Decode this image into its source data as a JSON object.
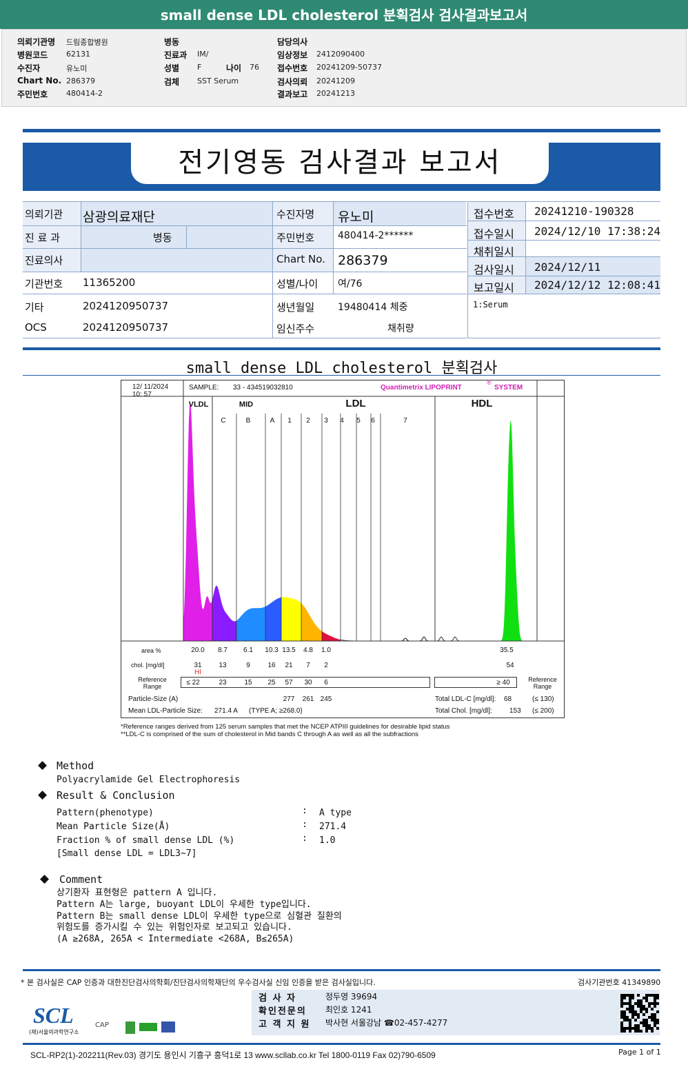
{
  "header": {
    "title": "small dense LDL cholesterol 분획검사 검사결과보고서"
  },
  "info": {
    "col1": [
      {
        "label": "의뢰기관명",
        "value": "드림종합병원"
      },
      {
        "label": "병원코드",
        "value": "62131"
      },
      {
        "label": "수진자",
        "value": "유노미"
      },
      {
        "label": "Chart No.",
        "value": "286379"
      },
      {
        "label": "주민번호",
        "value": "480414-2"
      }
    ],
    "col2": [
      {
        "label": "병동",
        "value": ""
      },
      {
        "label": "진료과",
        "value": "IM/"
      },
      {
        "label": "성별",
        "value": "F"
      },
      {
        "label": "검체",
        "value": "SST Serum"
      }
    ],
    "age_label": "나이",
    "age_value": "76",
    "col3": [
      {
        "label": "담당의사",
        "value": ""
      },
      {
        "label": "임상정보",
        "value": "2412090400"
      },
      {
        "label": "접수번호",
        "value": "20241209-50737"
      },
      {
        "label": "검사의뢰",
        "value": "20241209"
      },
      {
        "label": "결과보고",
        "value": "20241213"
      }
    ]
  },
  "report": {
    "title": "전기영동 검사결과 보고서",
    "left": [
      {
        "l1": "의뢰기관",
        "v1": "삼광의료재단",
        "l2": "수진자명",
        "v2": "유노미"
      },
      {
        "l1": "진 료 과",
        "v1": "병동",
        "l2": "주민번호",
        "v2": "480414-2******"
      },
      {
        "l1": "진료의사",
        "v1": "",
        "l2": "Chart No.",
        "v2": "286379"
      },
      {
        "l1": "기관번호",
        "v1": "11365200",
        "l2": "성별/나이",
        "v2": "여/76"
      },
      {
        "l1": "기타",
        "v1": "2024120950737",
        "l2": "생년월일",
        "v2": "19480414 체중"
      },
      {
        "l1": "OCS",
        "v1": "2024120950737",
        "l2": "임신주수",
        "v2": "채취량"
      }
    ],
    "right": [
      {
        "l": "접수번호",
        "v": "20241210-190328"
      },
      {
        "l": "접수일시",
        "v": "2024/12/10 17:38:24"
      },
      {
        "l": "채취일시",
        "v": ""
      },
      {
        "l": "검사일시",
        "v": "2024/12/11"
      },
      {
        "l": "보고일시",
        "v": "2024/12/12 12:08:41"
      }
    ],
    "specimen": "1:Serum",
    "subtitle": "small dense LDL cholesterol 분획검사"
  },
  "chart_data": {
    "type": "area",
    "date": "12/ 11/2024",
    "time": "10: 57",
    "sample_label": "SAMPLE:",
    "sample": "33 - 434519032810",
    "brand": "Quantimetrix LIPOPRINT",
    "brand_mark": "®",
    "brand_suffix": "SYSTEM",
    "groups": [
      "VLDL",
      "MID",
      "LDL",
      "HDL"
    ],
    "bands": [
      "C",
      "B",
      "A",
      "1",
      "2",
      "3",
      "4",
      "5",
      "6",
      "7"
    ],
    "colors": {
      "VLDL": "#e020e8",
      "C": "#8a1cff",
      "B": "#1f8cff",
      "A": "#2a5cff",
      "1": "#ffff00",
      "2": "#ffb400",
      "3": "#e0103c",
      "HDL": "#10e010"
    },
    "row_labels": {
      "area": "area %",
      "chol": "chol. [mg/dl]",
      "ref": "Reference Range",
      "ref_right": "Reference Range",
      "particle": "Particle-Size (A)",
      "mean": "Mean LDL-Particle Size:"
    },
    "area": [
      "20.0",
      "8.7",
      "6.1",
      "10.3",
      "13.5",
      "4.8",
      "1.0"
    ],
    "area_hdl": "35.5",
    "chol": [
      "31",
      "13",
      "9",
      "16",
      "21",
      "7",
      "2"
    ],
    "chol_hdl": "54",
    "chol_flag": "HI",
    "ref": [
      "≤ 22",
      "23",
      "15",
      "25",
      "57",
      "30",
      "6"
    ],
    "ref_hdl": "≥  40",
    "particle": [
      "277",
      "261",
      "245"
    ],
    "mean_value": "271.4  A",
    "mean_type": "(TYPE A; ≥268.0)",
    "total_ldl_label": "Total LDL-C  [mg/dl]:",
    "total_ldl": "68",
    "total_ldl_ref": "(≤ 130)",
    "total_chol_label": "Total Chol.  [mg/dl]:",
    "total_chol": "153",
    "total_chol_ref": "(≤ 200)",
    "footnote1": "*Reference ranges derived from 125 serum samples that met the NCEP ATPIII guidelines for desirable lipid status",
    "footnote2": "**LDL-C is comprised of the sum of cholesterol in Mid bands C through A as well as all the subfractions"
  },
  "method": {
    "title": "Method",
    "text": "Polyacrylamide Gel Electrophoresis"
  },
  "result": {
    "title": "Result & Conclusion",
    "rows": [
      {
        "l": "Pattern(phenotype)",
        "v": "A type"
      },
      {
        "l": "Mean Particle Size(Å)",
        "v": "271.4"
      },
      {
        "l": "Fraction % of small dense LDL (%)",
        "v": "1.0"
      }
    ],
    "note": "[Small dense LDL = LDL3~7]",
    "sep": ":"
  },
  "comment": {
    "title": "Comment",
    "lines": [
      "상기환자 표현형은 pattern A 입니다.",
      "Pattern A는 large, buoyant LDL이 우세한 type입니다.",
      "Pattern B는 small dense LDL이 우세한 type으로 심혈관 질환의",
      "위험도를 증가시킬 수 있는 위험인자로 보고되고 있습니다.",
      "(A ≥268A, 265A < Intermediate <268A, B≤265A)"
    ]
  },
  "footer": {
    "cert": "* 본 검사실은 CAP 인증과 대한진단검사의학회/진단검사의학재단의 우수검사실 신임 인증을 받은 검사실입니다.",
    "org_no": "검사기관번호 41349890",
    "staff": [
      {
        "l": "검  사  자",
        "v": "정두영 39694"
      },
      {
        "l": "확인전문의",
        "v": "최인호 1241"
      },
      {
        "l": "고 객 지 원",
        "v": "박사현 서울강남 ☎02-457-4277"
      }
    ],
    "logo": "SCL",
    "logo_sub": "(재)서울의과학연구소",
    "cap": "CAP",
    "address": "SCL-RP2(1)-202211(Rev.03)  경기도 용인시 기흥구 흥덕1로 13  www.scllab.co.kr   Tel 1800-0119   Fax 02)790-6509",
    "page": "Page 1 of 1"
  }
}
